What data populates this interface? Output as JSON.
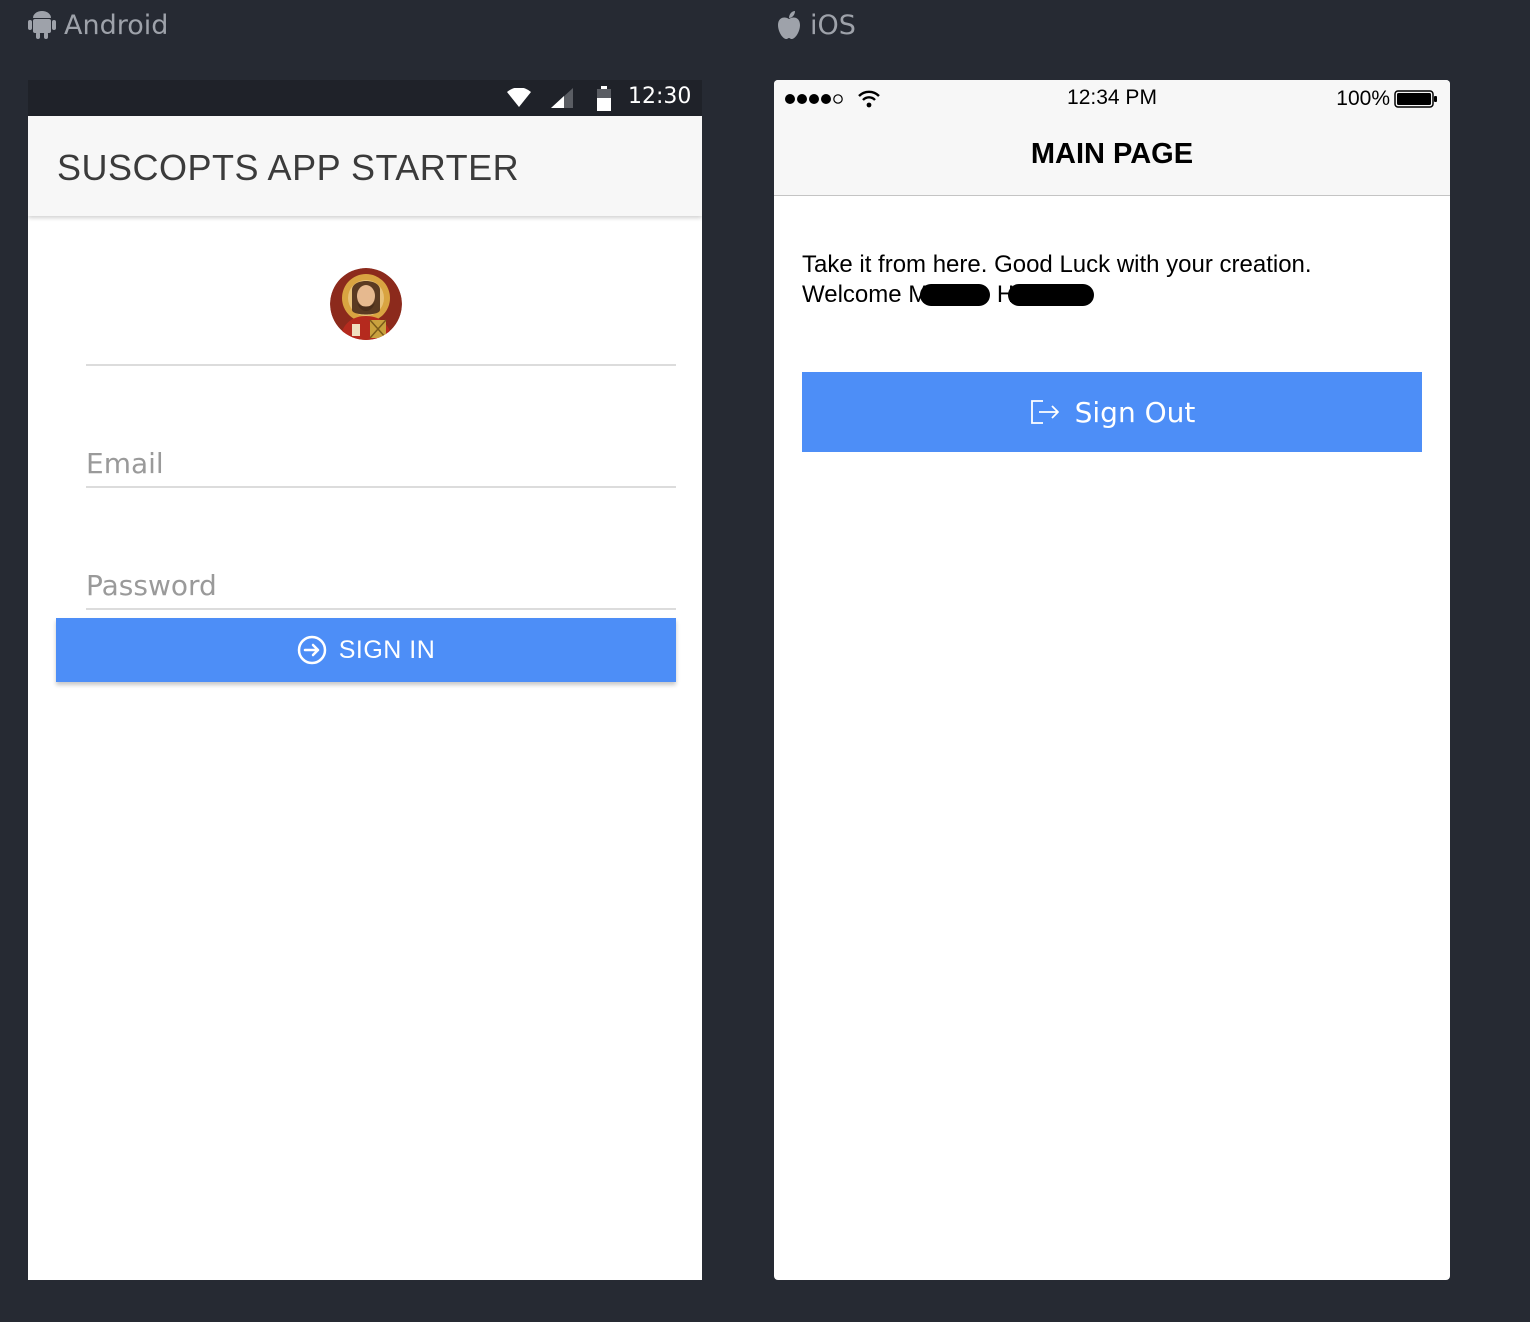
{
  "labels": {
    "android": "Android",
    "ios": "iOS"
  },
  "android": {
    "status_bar": {
      "time": "12:30",
      "icons": [
        "wifi-icon",
        "cell-signal-icon",
        "battery-icon"
      ]
    },
    "toolbar": {
      "title": "SUSCOPTS APP STARTER"
    },
    "form": {
      "email_placeholder": "Email",
      "password_placeholder": "Password",
      "sign_in_label": "SIGN IN",
      "sign_in_icon": "sign-in-icon"
    }
  },
  "ios": {
    "status_bar": {
      "time": "12:34 PM",
      "battery_percent": "100%",
      "icons": [
        "signal-dots-icon",
        "wifi-icon",
        "battery-icon"
      ]
    },
    "navbar": {
      "title": "MAIN PAGE"
    },
    "content": {
      "message_line1": "Take it from here. Good Luck with your creation.",
      "welcome_prefix": "Welcome M",
      "welcome_mid": " H"
    },
    "sign_out_label": "Sign Out",
    "sign_out_icon": "sign-out-icon"
  },
  "colors": {
    "background": "#262a33",
    "button_blue": "#4d8ef7",
    "android_status": "#1f2229",
    "toolbar_bg": "#f7f7f7"
  }
}
